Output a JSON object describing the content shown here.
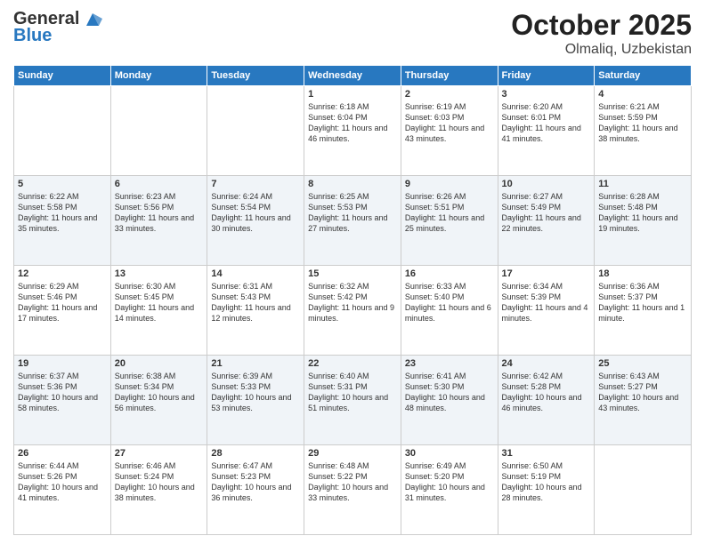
{
  "header": {
    "logo_general": "General",
    "logo_blue": "Blue",
    "title": "October 2025",
    "location": "Olmaliq, Uzbekistan"
  },
  "weekdays": [
    "Sunday",
    "Monday",
    "Tuesday",
    "Wednesday",
    "Thursday",
    "Friday",
    "Saturday"
  ],
  "weeks": [
    [
      {
        "day": "",
        "sunrise": "",
        "sunset": "",
        "daylight": ""
      },
      {
        "day": "",
        "sunrise": "",
        "sunset": "",
        "daylight": ""
      },
      {
        "day": "",
        "sunrise": "",
        "sunset": "",
        "daylight": ""
      },
      {
        "day": "1",
        "sunrise": "Sunrise: 6:18 AM",
        "sunset": "Sunset: 6:04 PM",
        "daylight": "Daylight: 11 hours and 46 minutes."
      },
      {
        "day": "2",
        "sunrise": "Sunrise: 6:19 AM",
        "sunset": "Sunset: 6:03 PM",
        "daylight": "Daylight: 11 hours and 43 minutes."
      },
      {
        "day": "3",
        "sunrise": "Sunrise: 6:20 AM",
        "sunset": "Sunset: 6:01 PM",
        "daylight": "Daylight: 11 hours and 41 minutes."
      },
      {
        "day": "4",
        "sunrise": "Sunrise: 6:21 AM",
        "sunset": "Sunset: 5:59 PM",
        "daylight": "Daylight: 11 hours and 38 minutes."
      }
    ],
    [
      {
        "day": "5",
        "sunrise": "Sunrise: 6:22 AM",
        "sunset": "Sunset: 5:58 PM",
        "daylight": "Daylight: 11 hours and 35 minutes."
      },
      {
        "day": "6",
        "sunrise": "Sunrise: 6:23 AM",
        "sunset": "Sunset: 5:56 PM",
        "daylight": "Daylight: 11 hours and 33 minutes."
      },
      {
        "day": "7",
        "sunrise": "Sunrise: 6:24 AM",
        "sunset": "Sunset: 5:54 PM",
        "daylight": "Daylight: 11 hours and 30 minutes."
      },
      {
        "day": "8",
        "sunrise": "Sunrise: 6:25 AM",
        "sunset": "Sunset: 5:53 PM",
        "daylight": "Daylight: 11 hours and 27 minutes."
      },
      {
        "day": "9",
        "sunrise": "Sunrise: 6:26 AM",
        "sunset": "Sunset: 5:51 PM",
        "daylight": "Daylight: 11 hours and 25 minutes."
      },
      {
        "day": "10",
        "sunrise": "Sunrise: 6:27 AM",
        "sunset": "Sunset: 5:49 PM",
        "daylight": "Daylight: 11 hours and 22 minutes."
      },
      {
        "day": "11",
        "sunrise": "Sunrise: 6:28 AM",
        "sunset": "Sunset: 5:48 PM",
        "daylight": "Daylight: 11 hours and 19 minutes."
      }
    ],
    [
      {
        "day": "12",
        "sunrise": "Sunrise: 6:29 AM",
        "sunset": "Sunset: 5:46 PM",
        "daylight": "Daylight: 11 hours and 17 minutes."
      },
      {
        "day": "13",
        "sunrise": "Sunrise: 6:30 AM",
        "sunset": "Sunset: 5:45 PM",
        "daylight": "Daylight: 11 hours and 14 minutes."
      },
      {
        "day": "14",
        "sunrise": "Sunrise: 6:31 AM",
        "sunset": "Sunset: 5:43 PM",
        "daylight": "Daylight: 11 hours and 12 minutes."
      },
      {
        "day": "15",
        "sunrise": "Sunrise: 6:32 AM",
        "sunset": "Sunset: 5:42 PM",
        "daylight": "Daylight: 11 hours and 9 minutes."
      },
      {
        "day": "16",
        "sunrise": "Sunrise: 6:33 AM",
        "sunset": "Sunset: 5:40 PM",
        "daylight": "Daylight: 11 hours and 6 minutes."
      },
      {
        "day": "17",
        "sunrise": "Sunrise: 6:34 AM",
        "sunset": "Sunset: 5:39 PM",
        "daylight": "Daylight: 11 hours and 4 minutes."
      },
      {
        "day": "18",
        "sunrise": "Sunrise: 6:36 AM",
        "sunset": "Sunset: 5:37 PM",
        "daylight": "Daylight: 11 hours and 1 minute."
      }
    ],
    [
      {
        "day": "19",
        "sunrise": "Sunrise: 6:37 AM",
        "sunset": "Sunset: 5:36 PM",
        "daylight": "Daylight: 10 hours and 58 minutes."
      },
      {
        "day": "20",
        "sunrise": "Sunrise: 6:38 AM",
        "sunset": "Sunset: 5:34 PM",
        "daylight": "Daylight: 10 hours and 56 minutes."
      },
      {
        "day": "21",
        "sunrise": "Sunrise: 6:39 AM",
        "sunset": "Sunset: 5:33 PM",
        "daylight": "Daylight: 10 hours and 53 minutes."
      },
      {
        "day": "22",
        "sunrise": "Sunrise: 6:40 AM",
        "sunset": "Sunset: 5:31 PM",
        "daylight": "Daylight: 10 hours and 51 minutes."
      },
      {
        "day": "23",
        "sunrise": "Sunrise: 6:41 AM",
        "sunset": "Sunset: 5:30 PM",
        "daylight": "Daylight: 10 hours and 48 minutes."
      },
      {
        "day": "24",
        "sunrise": "Sunrise: 6:42 AM",
        "sunset": "Sunset: 5:28 PM",
        "daylight": "Daylight: 10 hours and 46 minutes."
      },
      {
        "day": "25",
        "sunrise": "Sunrise: 6:43 AM",
        "sunset": "Sunset: 5:27 PM",
        "daylight": "Daylight: 10 hours and 43 minutes."
      }
    ],
    [
      {
        "day": "26",
        "sunrise": "Sunrise: 6:44 AM",
        "sunset": "Sunset: 5:26 PM",
        "daylight": "Daylight: 10 hours and 41 minutes."
      },
      {
        "day": "27",
        "sunrise": "Sunrise: 6:46 AM",
        "sunset": "Sunset: 5:24 PM",
        "daylight": "Daylight: 10 hours and 38 minutes."
      },
      {
        "day": "28",
        "sunrise": "Sunrise: 6:47 AM",
        "sunset": "Sunset: 5:23 PM",
        "daylight": "Daylight: 10 hours and 36 minutes."
      },
      {
        "day": "29",
        "sunrise": "Sunrise: 6:48 AM",
        "sunset": "Sunset: 5:22 PM",
        "daylight": "Daylight: 10 hours and 33 minutes."
      },
      {
        "day": "30",
        "sunrise": "Sunrise: 6:49 AM",
        "sunset": "Sunset: 5:20 PM",
        "daylight": "Daylight: 10 hours and 31 minutes."
      },
      {
        "day": "31",
        "sunrise": "Sunrise: 6:50 AM",
        "sunset": "Sunset: 5:19 PM",
        "daylight": "Daylight: 10 hours and 28 minutes."
      },
      {
        "day": "",
        "sunrise": "",
        "sunset": "",
        "daylight": ""
      }
    ]
  ]
}
